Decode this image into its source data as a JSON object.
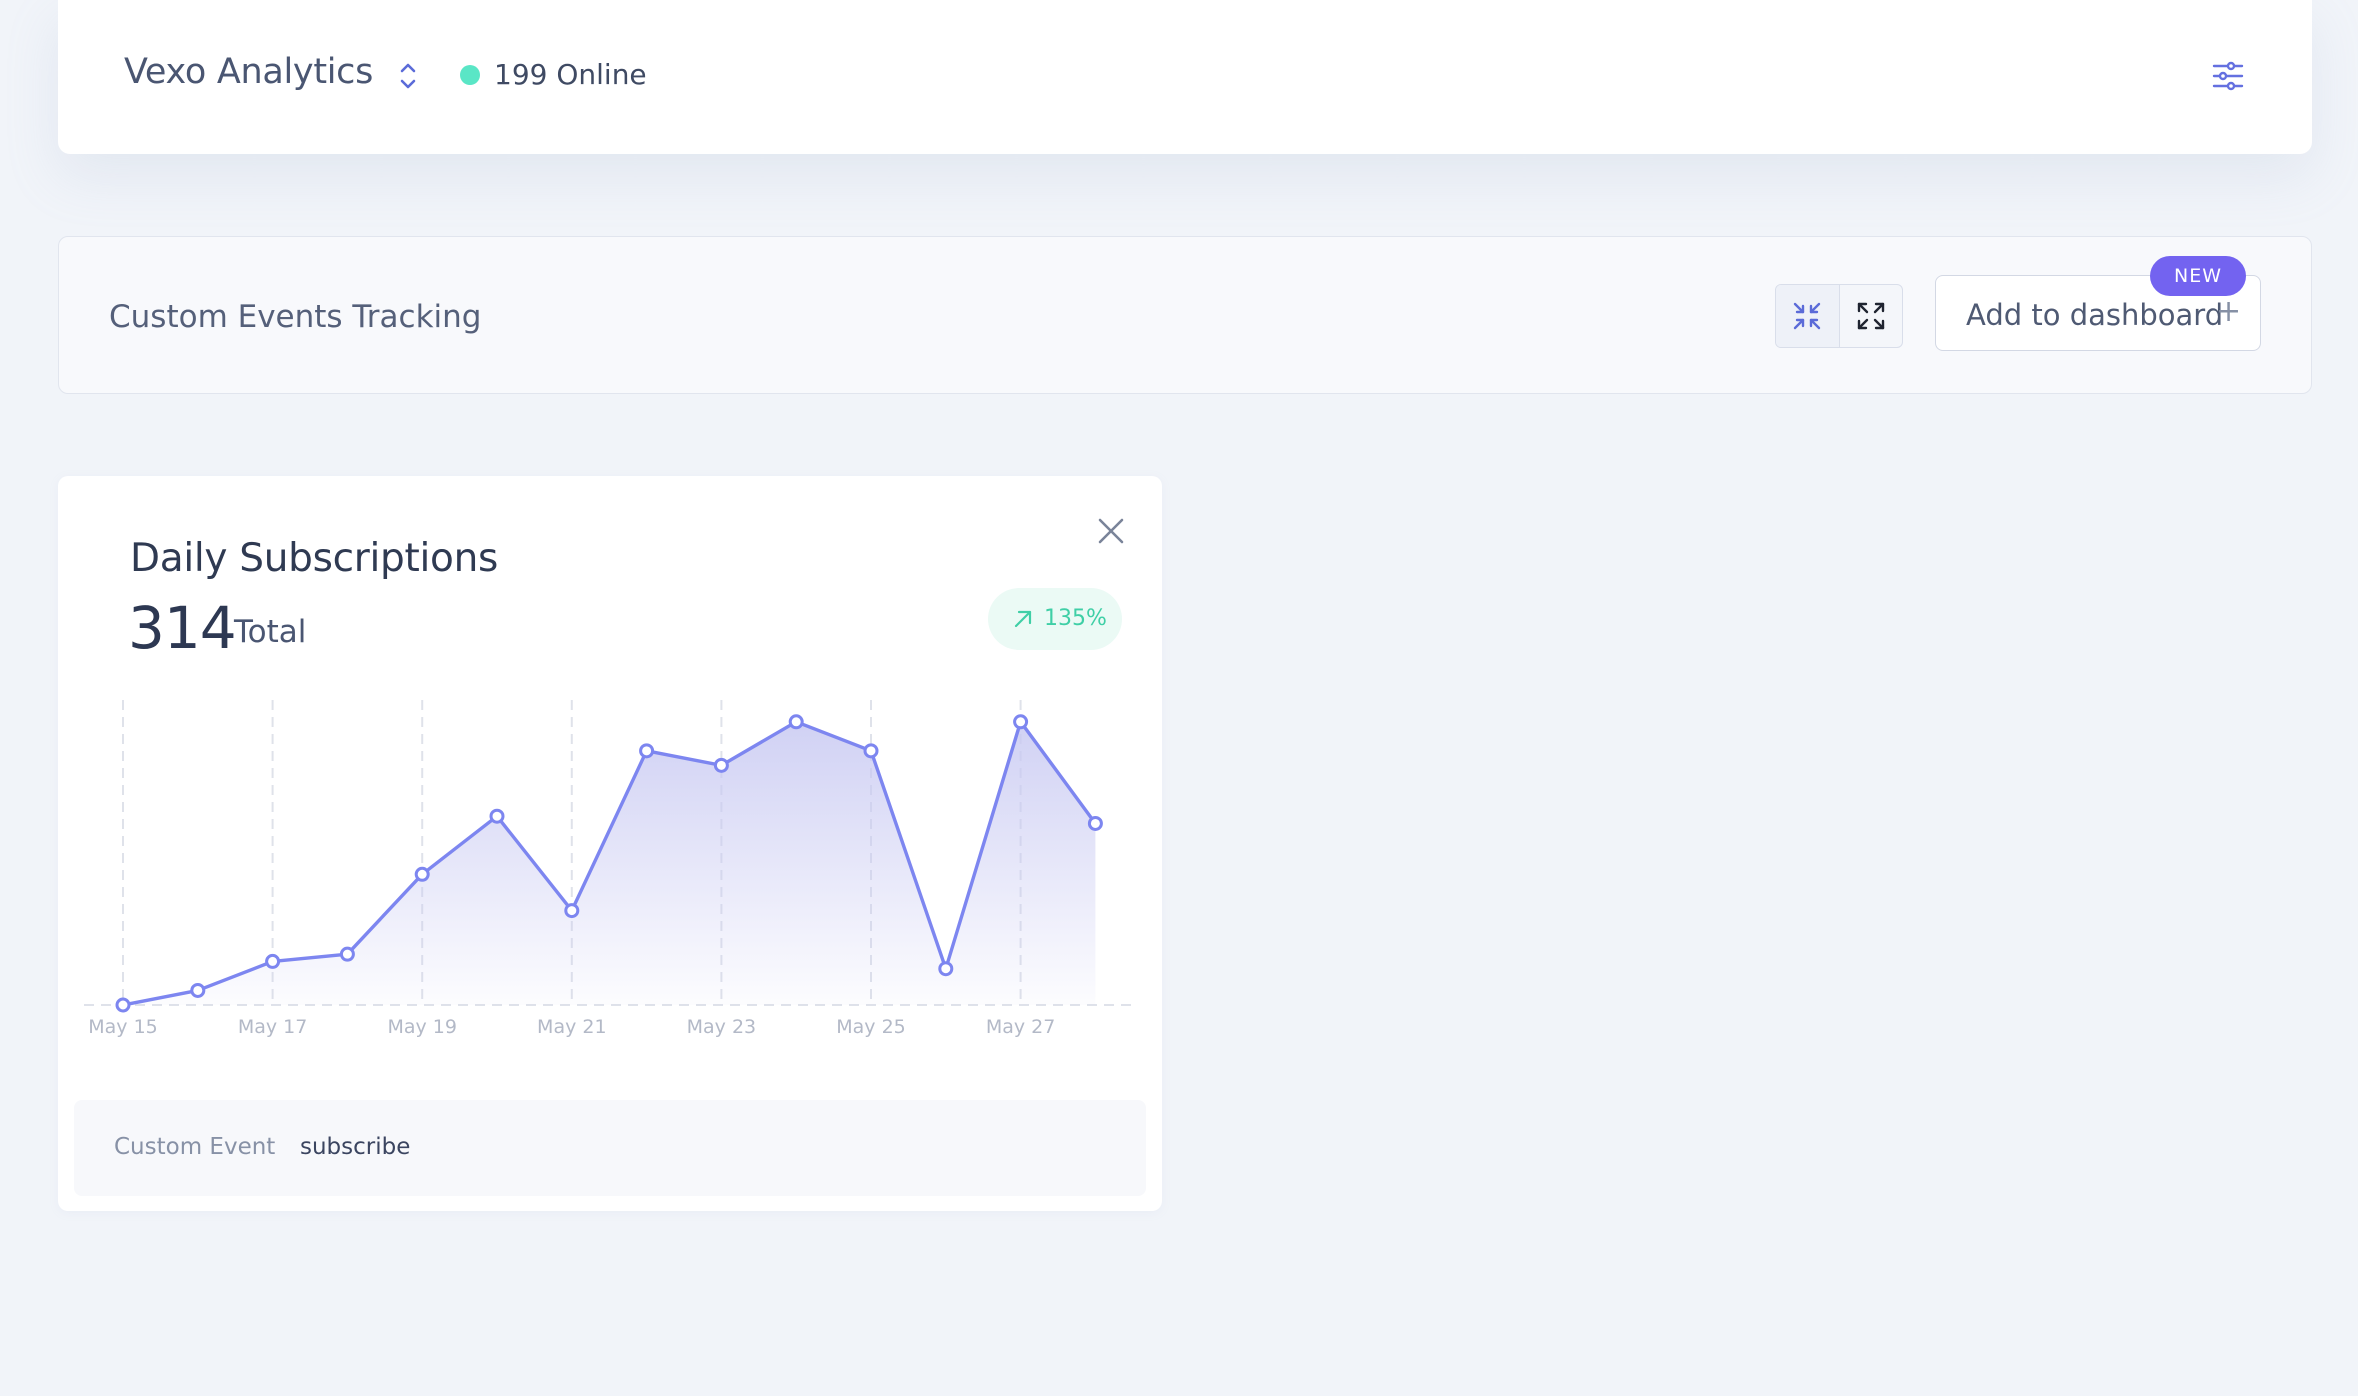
{
  "header": {
    "brand": "Vexo Analytics",
    "online_text": "199 Online",
    "online_color": "#5ae6c6",
    "icons": [
      "chevron-up-down-icon",
      "sliders-icon"
    ]
  },
  "section": {
    "title": "Custom Events Tracking",
    "add_label": "Add to dashboard",
    "add_plus": "+",
    "new_badge": "NEW",
    "view_icons": [
      "collapse-icon",
      "expand-icon"
    ]
  },
  "card": {
    "title": "Daily Subscriptions",
    "total": "314",
    "total_label": "Total",
    "trend": "135%",
    "event_key": "Custom Event",
    "event_value": "subscribe"
  },
  "chart_data": {
    "type": "area",
    "x": [
      "May 15",
      "May 16",
      "May 17",
      "May 18",
      "May 19",
      "May 20",
      "May 21",
      "May 22",
      "May 23",
      "May 24",
      "May 25",
      "May 26",
      "May 27",
      "May 28"
    ],
    "tick_labels": [
      "May 15",
      "May 17",
      "May 19",
      "May 21",
      "May 23",
      "May 25",
      "May 27"
    ],
    "values": [
      0,
      2,
      6,
      7,
      18,
      26,
      13,
      35,
      33,
      39,
      35,
      5,
      39,
      25
    ],
    "ylim": [
      0,
      42
    ],
    "grid": "vertical-dashed",
    "line_color": "#7d86f0",
    "fill_color": "#c8c9f2"
  }
}
